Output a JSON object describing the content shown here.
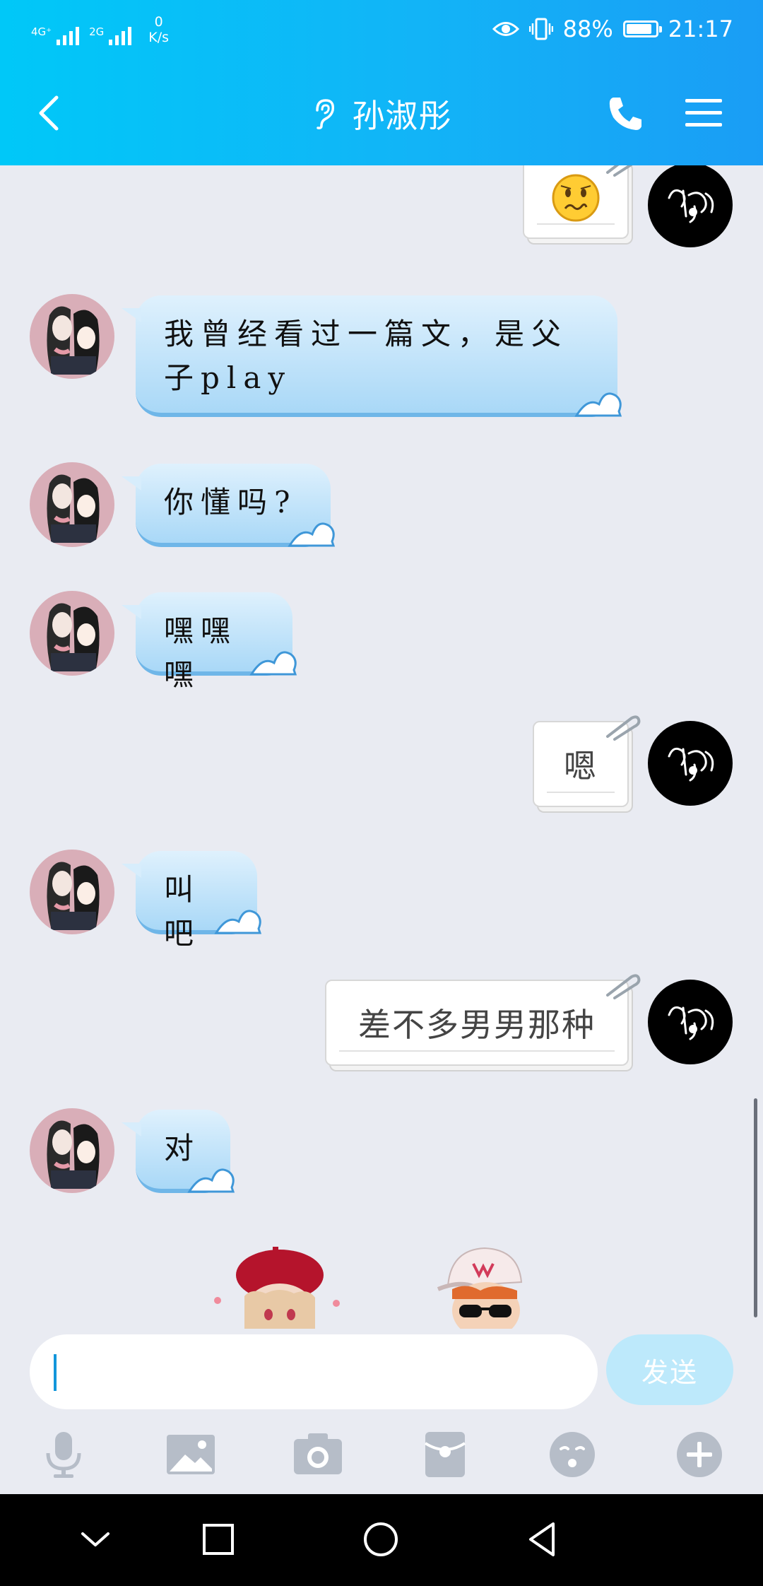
{
  "status_bar": {
    "signal1_tag": "4G⁺",
    "signal2_tag": "2G",
    "net_speed_value": "0",
    "net_speed_unit": "K/s",
    "battery_text": "88%",
    "battery_level": 0.88,
    "time": "21:17"
  },
  "header": {
    "title": "孙淑彤",
    "icons": [
      "back-icon",
      "ear-icon",
      "phone-icon",
      "menu-icon"
    ]
  },
  "messages": [
    {
      "from": "me",
      "type": "emoji",
      "icon": "worried-face-icon"
    },
    {
      "from": "her",
      "text": "我曾经看过一篇文，是父子play"
    },
    {
      "from": "her",
      "text": "你懂吗?"
    },
    {
      "from": "her",
      "text": "嘿嘿嘿"
    },
    {
      "from": "me",
      "text": "嗯"
    },
    {
      "from": "her",
      "text": "叫吧"
    },
    {
      "from": "me",
      "text": "差不多男男那种"
    },
    {
      "from": "her",
      "text": "对"
    }
  ],
  "composer": {
    "input_value": "",
    "send_label": "发送",
    "tools": [
      "microphone-icon",
      "image-icon",
      "camera-icon",
      "red-packet-icon",
      "emoji-icon",
      "plus-icon"
    ]
  },
  "colors": {
    "header_start": "#00c8f8",
    "header_end": "#1a9df5",
    "chat_bg": "#e9ebf2",
    "bubble_in": "#a9d8f7",
    "send_button": "#bde9fb"
  }
}
